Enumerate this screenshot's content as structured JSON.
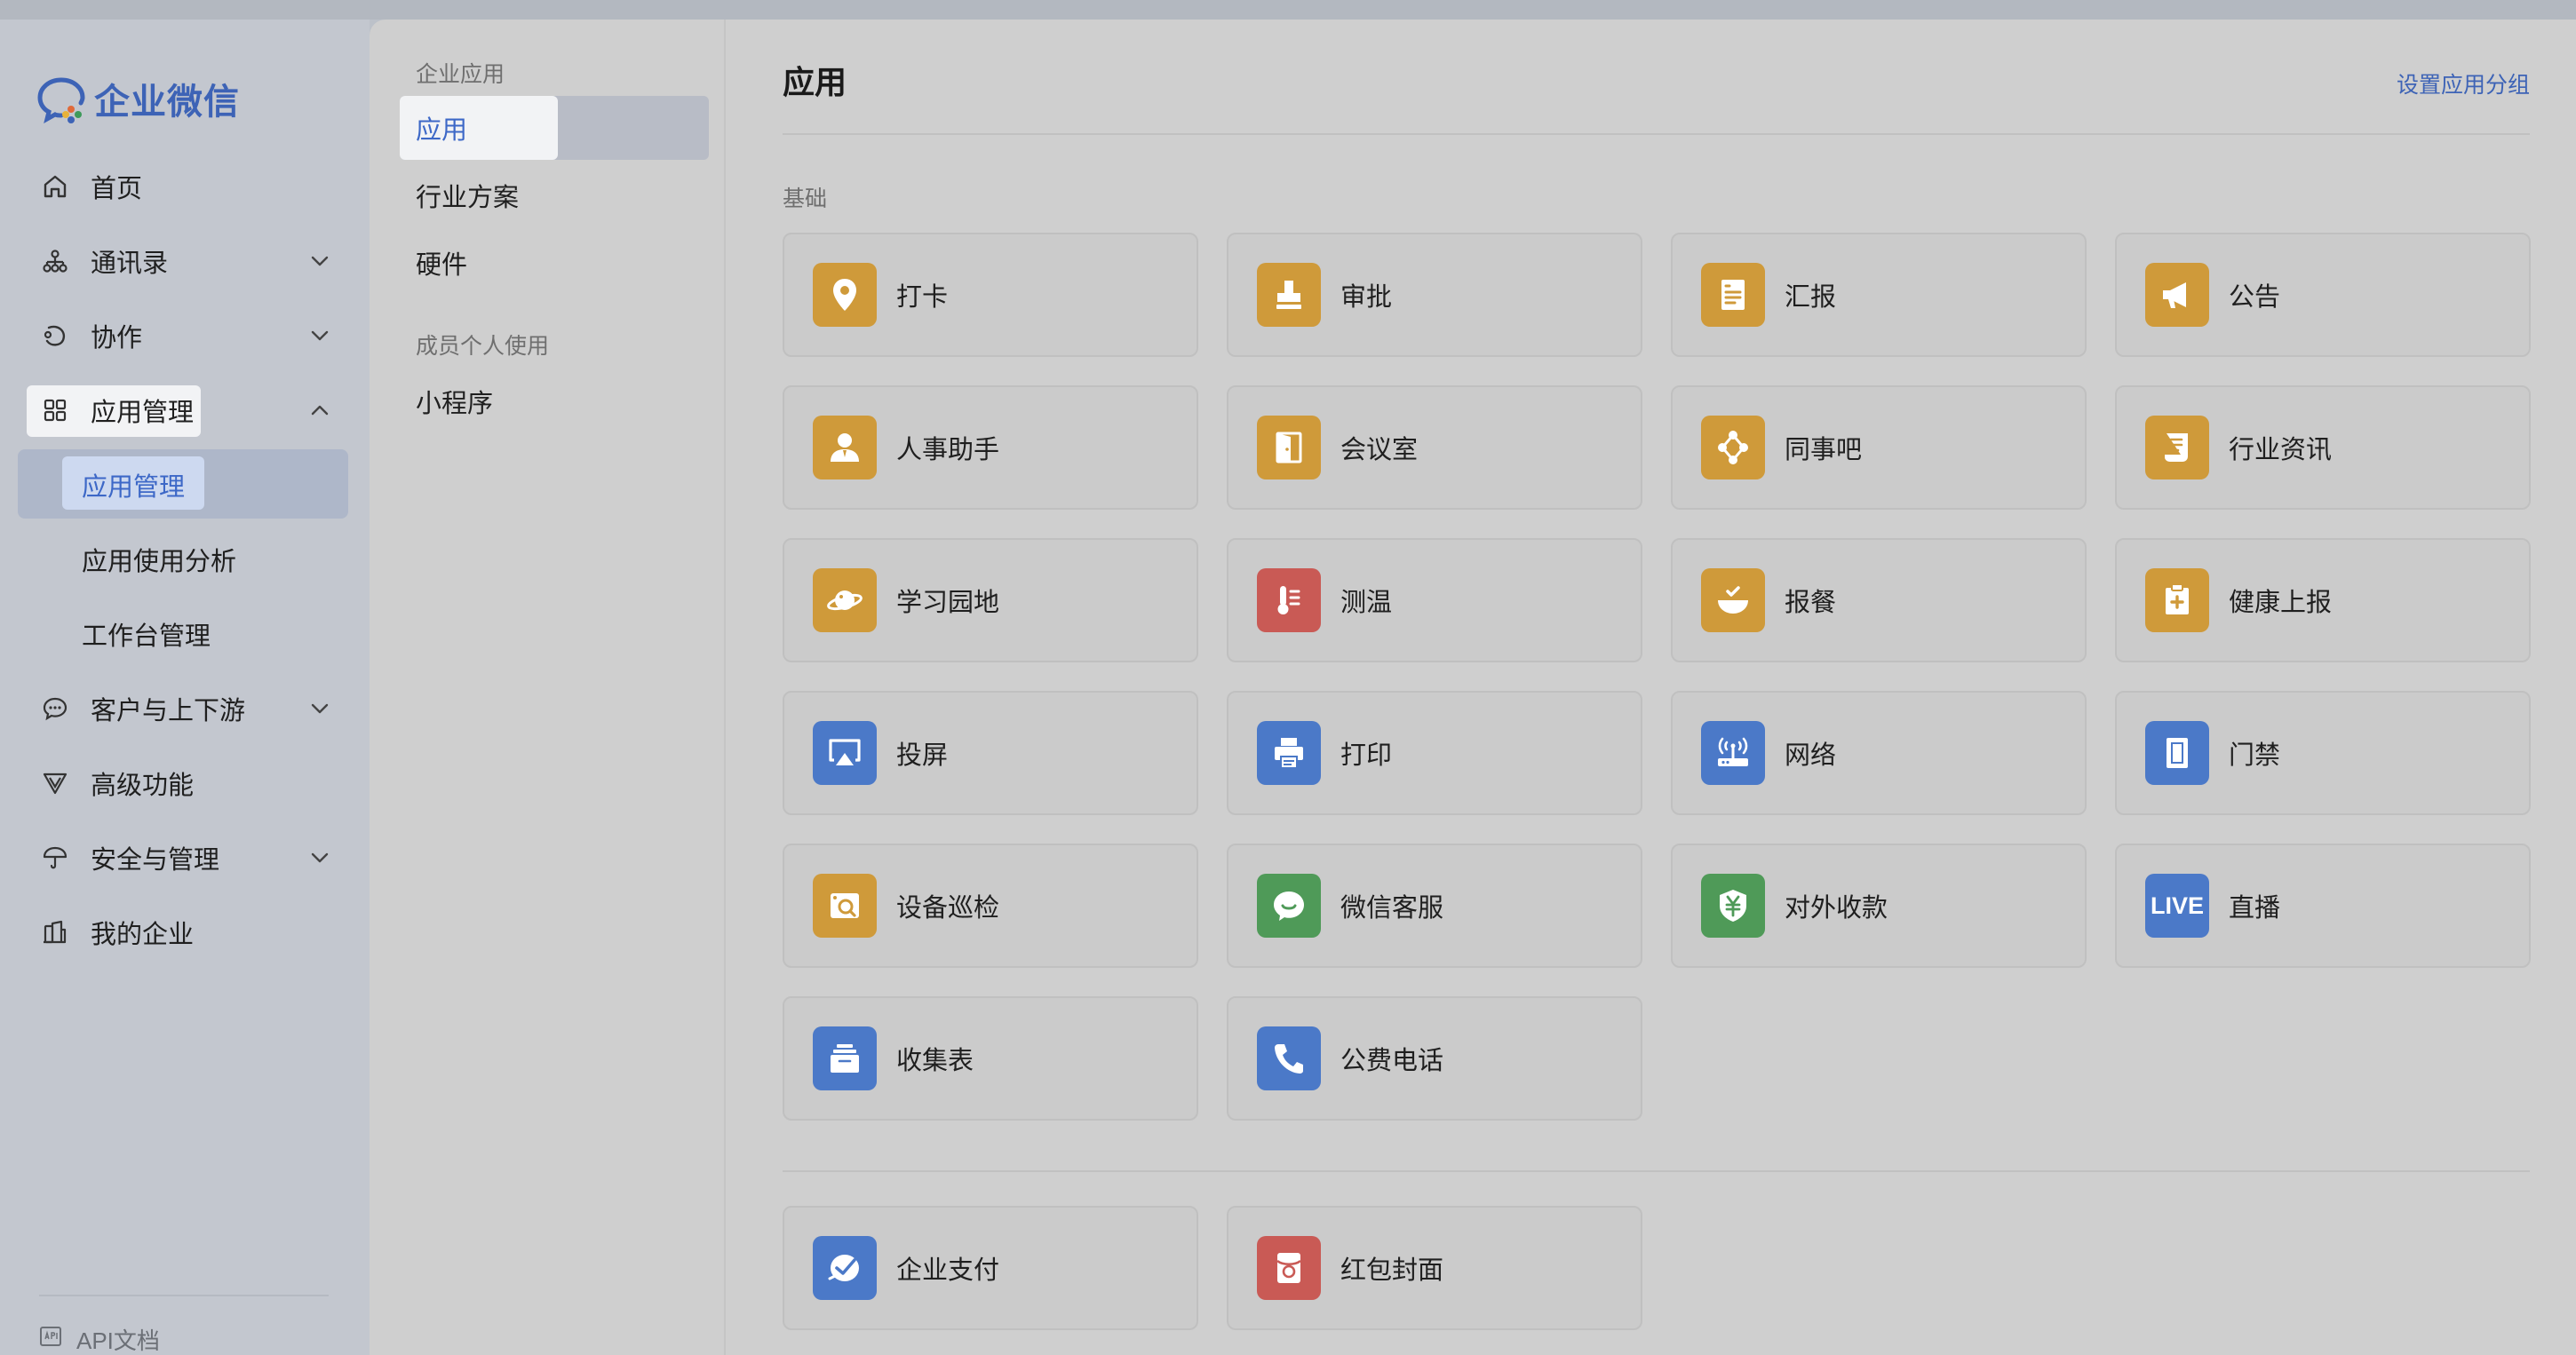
{
  "brand": {
    "name": "企业微信",
    "color": "#3d63b6"
  },
  "sidebar": {
    "items": [
      {
        "label": "首页",
        "icon": "home-icon",
        "expandable": false
      },
      {
        "label": "通讯录",
        "icon": "org-chart-icon",
        "expandable": true
      },
      {
        "label": "协作",
        "icon": "collaboration-icon",
        "expandable": true
      },
      {
        "label": "应用管理",
        "icon": "apps-grid-icon",
        "expandable": true,
        "expanded": true,
        "children": [
          {
            "label": "应用管理",
            "active": true
          },
          {
            "label": "应用使用分析"
          },
          {
            "label": "工作台管理"
          }
        ]
      },
      {
        "label": "客户与上下游",
        "icon": "chat-bubble-icon",
        "expandable": true
      },
      {
        "label": "高级功能",
        "icon": "filter-v-icon",
        "expandable": false
      },
      {
        "label": "安全与管理",
        "icon": "umbrella-icon",
        "expandable": true
      },
      {
        "label": "我的企业",
        "icon": "buildings-icon",
        "expandable": false
      }
    ],
    "footer": {
      "label": "API文档",
      "icon": "api-doc-icon"
    }
  },
  "midnav": {
    "section1": "企业应用",
    "items1": [
      "应用",
      "行业方案",
      "硬件"
    ],
    "active": "应用",
    "section2": "成员个人使用",
    "items2": [
      "小程序"
    ]
  },
  "main": {
    "title": "应用",
    "link": "设置应用分组",
    "category": "基础",
    "apps": [
      {
        "name": "打卡",
        "icon": "location-pin-icon",
        "color": "#cf9a3a"
      },
      {
        "name": "审批",
        "icon": "stamp-icon",
        "color": "#cf9a3a"
      },
      {
        "name": "汇报",
        "icon": "report-doc-icon",
        "color": "#cf9a3a"
      },
      {
        "name": "公告",
        "icon": "megaphone-icon",
        "color": "#cf9a3a"
      },
      {
        "name": "人事助手",
        "icon": "hr-person-icon",
        "color": "#cf9a3a"
      },
      {
        "name": "会议室",
        "icon": "door-icon",
        "color": "#cf9a3a"
      },
      {
        "name": "同事吧",
        "icon": "network-nodes-icon",
        "color": "#cf9a3a"
      },
      {
        "name": "行业资讯",
        "icon": "news-doc-icon",
        "color": "#cf9a3a"
      },
      {
        "name": "学习园地",
        "icon": "planet-icon",
        "color": "#cf9a3a"
      },
      {
        "name": "测温",
        "icon": "thermometer-icon",
        "color": "#c95a55"
      },
      {
        "name": "报餐",
        "icon": "meal-bowl-icon",
        "color": "#cf9a3a"
      },
      {
        "name": "健康上报",
        "icon": "health-clipboard-icon",
        "color": "#cf9a3a"
      },
      {
        "name": "投屏",
        "icon": "airplay-icon",
        "color": "#4b79c8"
      },
      {
        "name": "打印",
        "icon": "printer-icon",
        "color": "#4b79c8"
      },
      {
        "name": "网络",
        "icon": "router-icon",
        "color": "#4b79c8"
      },
      {
        "name": "门禁",
        "icon": "access-door-icon",
        "color": "#4b79c8"
      },
      {
        "name": "设备巡检",
        "icon": "device-inspect-icon",
        "color": "#cf9a3a"
      },
      {
        "name": "微信客服",
        "icon": "wechat-service-icon",
        "color": "#4f9a58"
      },
      {
        "name": "对外收款",
        "icon": "yuan-shield-icon",
        "color": "#4f9a58"
      },
      {
        "name": "直播",
        "icon": "live-icon",
        "color": "#4b79c8"
      },
      {
        "name": "收集表",
        "icon": "collect-tray-icon",
        "color": "#4b79c8"
      },
      {
        "name": "公费电话",
        "icon": "phone-icon",
        "color": "#4b79c8"
      }
    ],
    "apps2": [
      {
        "name": "企业支付",
        "icon": "enterprise-pay-icon",
        "color": "#4b79c8"
      },
      {
        "name": "红包封面",
        "icon": "red-envelope-icon",
        "color": "#c95a55"
      }
    ],
    "live_text": "LIVE"
  }
}
